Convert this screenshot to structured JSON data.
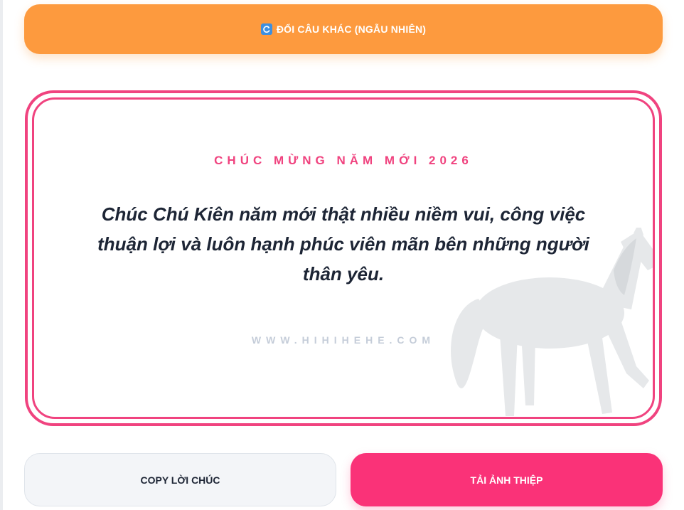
{
  "colors": {
    "accent_orange": "#fd9a3e",
    "accent_pink": "#f0437f",
    "button_pink": "#fa3278",
    "text_dark": "#1d2535",
    "watermark": "#c5cdd9"
  },
  "random_button": {
    "icon": "refresh-icon",
    "label": "ĐỔI CÂU KHÁC (NGẪU NHIÊN)"
  },
  "card": {
    "heading": "CHÚC MỪNG NĂM MỚI 2026",
    "wish": "Chúc Chú Kiên năm mới thật nhiều niềm vui, công việc thuận lợi và luôn hạnh phúc viên mãn bên những người thân yêu.",
    "watermark": "WWW.HIHIHEHE.COM",
    "decoration": "horse-illustration"
  },
  "actions": {
    "copy_label": "COPY LỜI CHÚC",
    "download_label": "TẢI ẢNH THIỆP"
  }
}
